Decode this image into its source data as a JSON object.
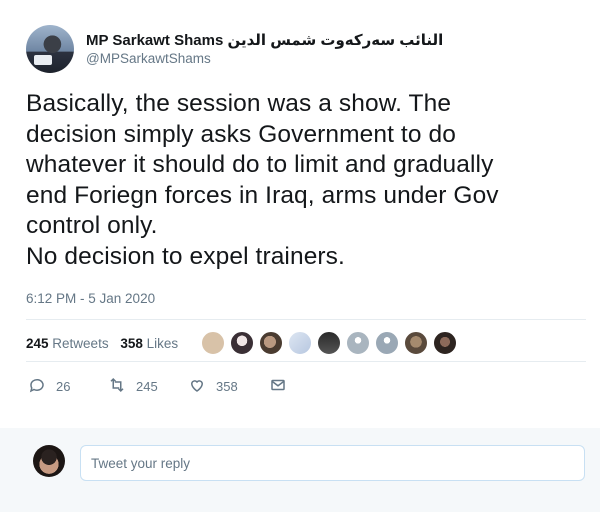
{
  "author": {
    "name": "MP Sarkawt Shams النائب سەرکەوت شمس الدين",
    "handle": "@MPSarkawtShams"
  },
  "tweet": {
    "lines": [
      "Basically, the session was a show. The",
      "decision simply asks Government to do",
      "whatever it should do to limit and gradually",
      "end Foriegn forces in Iraq, arms under Gov",
      "control only.",
      "No decision to expel trainers."
    ],
    "timestamp": "6:12 PM - 5 Jan 2020"
  },
  "stats": {
    "retweets_count": "245",
    "retweets_label": "Retweets",
    "likes_count": "358",
    "likes_label": "Likes"
  },
  "actions": {
    "reply_count": "26",
    "retweet_count": "245",
    "like_count": "358",
    "icons": [
      "reply-icon",
      "retweet-icon",
      "heart-icon",
      "message-icon"
    ]
  },
  "reply": {
    "placeholder": "Tweet your reply"
  },
  "colors": {
    "text": "#14171a",
    "muted": "#657786",
    "divider": "#e6ecf0",
    "reply_bg": "#f5f8fa",
    "reply_border": "#c8e0f3"
  }
}
